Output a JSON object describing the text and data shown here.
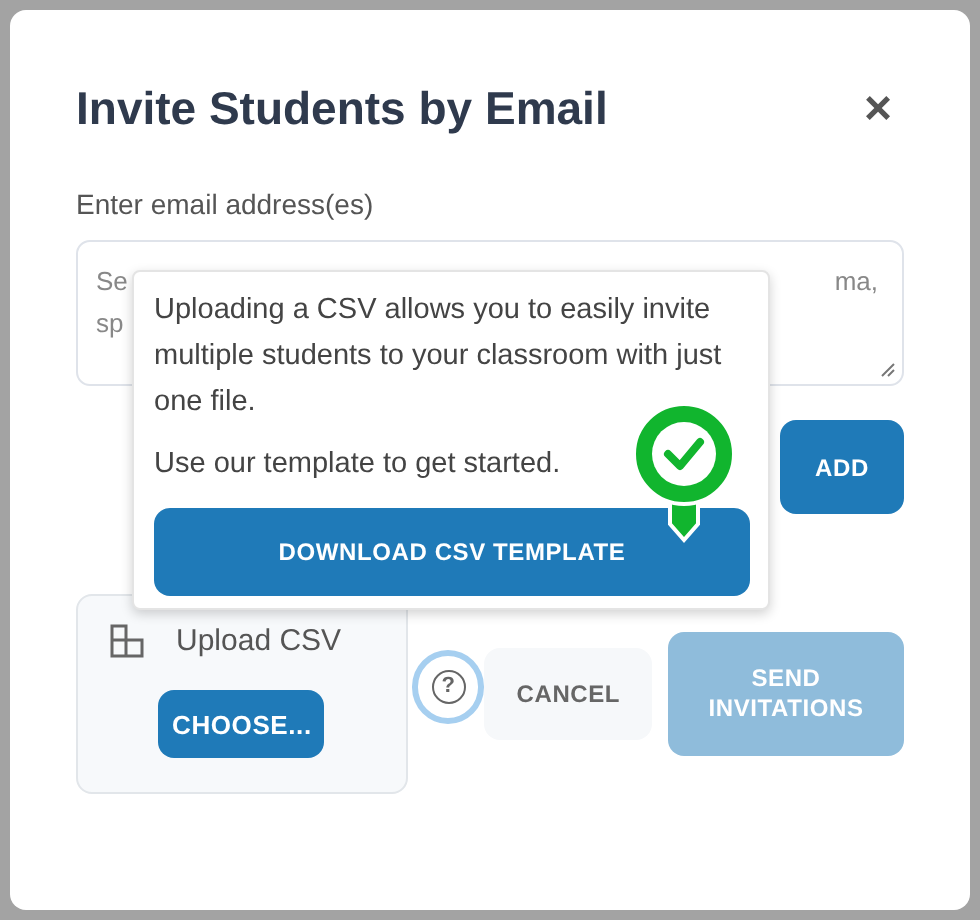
{
  "dialog": {
    "title": "Invite Students by Email",
    "close": "×"
  },
  "email_field": {
    "label": "Enter email address(es)",
    "placeholder_visible_left": [
      "Se",
      "sp"
    ],
    "placeholder_visible_right": "ma,"
  },
  "add_button": "ADD",
  "upload": {
    "label": "Upload CSV",
    "button": "CHOOSE..."
  },
  "help": "?",
  "cancel_button": "CANCEL",
  "send_button": {
    "label": "SEND INVITATIONS",
    "disabled": true
  },
  "popover": {
    "paragraphs": [
      "Uploading a CSV allows you to easily invite multiple students to your classroom with just one file.",
      "Use our template to get started."
    ],
    "button": "DOWNLOAD CSV TEMPLATE"
  }
}
